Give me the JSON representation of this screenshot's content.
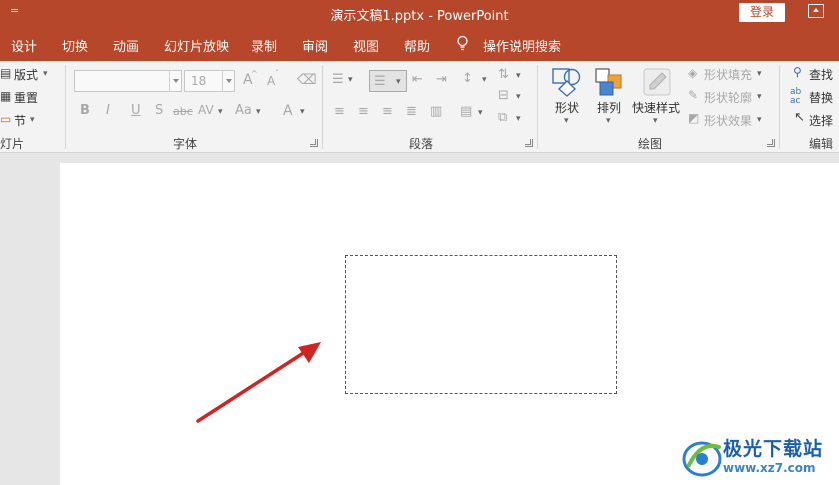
{
  "titlebar": {
    "quick_access": "=",
    "title": "演示文稿1.pptx  -  PowerPoint",
    "login": "登录"
  },
  "tabs": [
    "设计",
    "切换",
    "动画",
    "幻灯片放映",
    "录制",
    "审阅",
    "视图",
    "帮助",
    "操作说明搜索"
  ],
  "ribbon": {
    "slides_group": {
      "layout": "版式",
      "reset": "重置",
      "section": "节",
      "label": "灯片"
    },
    "font_group": {
      "font_name": "",
      "font_size": "18",
      "label": "字体",
      "grow": "A",
      "shrink": "A",
      "bold": "B",
      "italic": "I",
      "underline": "U",
      "shadow": "S",
      "strike": "abc",
      "spacing": "AV",
      "case": "Aa",
      "color": "A"
    },
    "paragraph_group": {
      "label": "段落"
    },
    "drawing_group": {
      "shapes": "形状",
      "arrange": "排列",
      "quick_styles": "快速样式",
      "fill": "形状填充",
      "outline": "形状轮廓",
      "effects": "形状效果",
      "label": "绘图"
    },
    "editing_group": {
      "find": "查找",
      "replace": "替换",
      "select": "选择",
      "label": "编辑"
    }
  },
  "watermark": {
    "title": "极光下载站",
    "url": "www.xz7.com"
  },
  "colors": {
    "accent": "#b7472a",
    "arrow": "#d32222"
  }
}
